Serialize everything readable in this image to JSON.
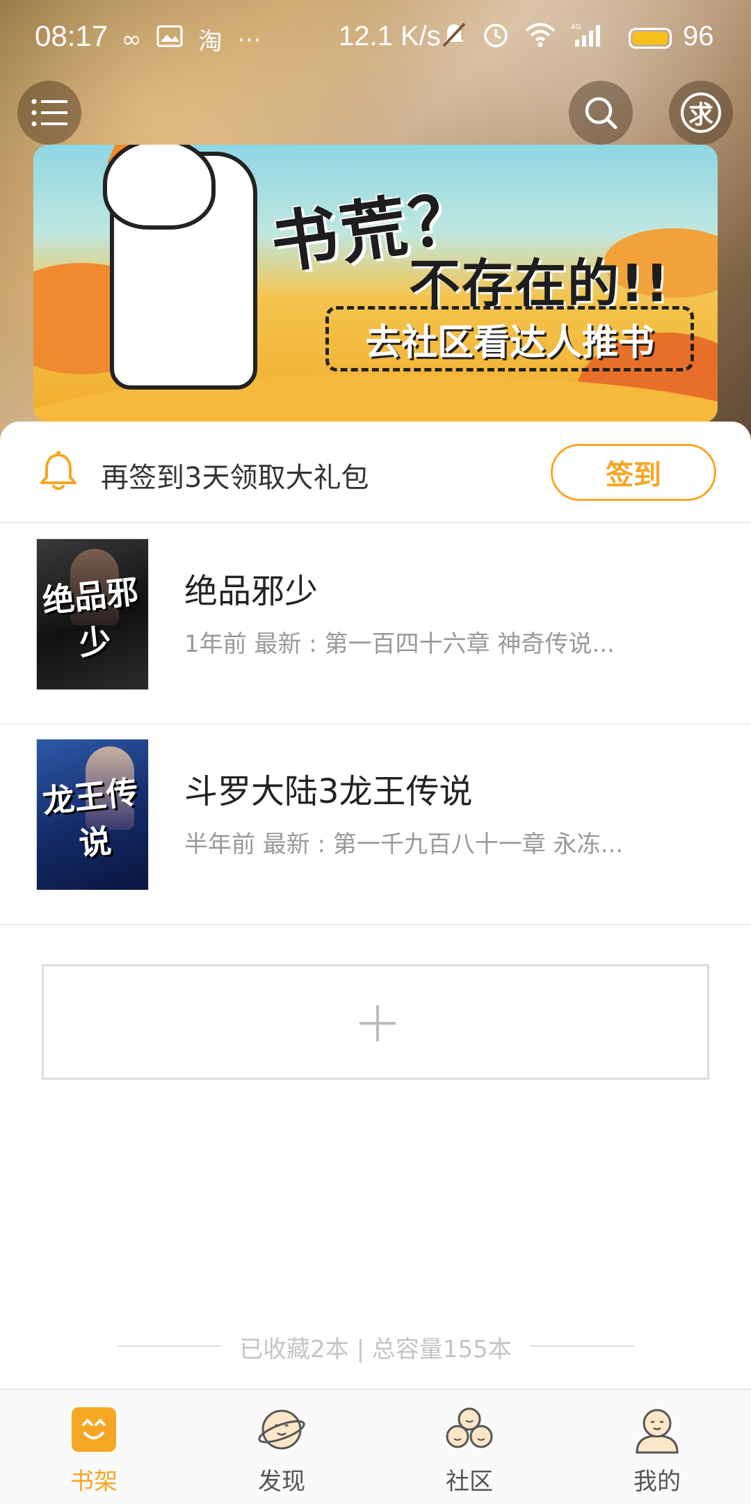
{
  "status_bar": {
    "time": "08:17",
    "net_speed": "12.1 K/s",
    "battery": "96",
    "left_icons": [
      "infinity-icon",
      "image-icon",
      "taobao-icon",
      "more-icon"
    ],
    "right_icons": [
      "mute-icon",
      "alarm-icon",
      "wifi-icon",
      "signal-4g-icon",
      "battery-icon"
    ]
  },
  "header": {
    "menu_icon": "menu-icon",
    "search_icon": "search-icon",
    "request_icon_text": "求"
  },
  "banner": {
    "headline": "书荒？",
    "subline": "不存在的!!",
    "cta": "去社区看达人推书"
  },
  "signin": {
    "text": "再签到3天领取大礼包",
    "button": "签到"
  },
  "books": [
    {
      "title": "绝品邪少",
      "subtitle": "1年前 最新 : 第一百四十六章 神奇传说...",
      "cover_title": "绝品邪少"
    },
    {
      "title": "斗罗大陆3龙王传说",
      "subtitle": "半年前 最新 : 第一千九百八十一章 永冻...",
      "cover_title": "龙王传说"
    }
  ],
  "footer": {
    "summary": "已收藏2本 | 总容量155本"
  },
  "tabs": [
    {
      "label": "书架",
      "icon": "bookshelf-icon",
      "active": true
    },
    {
      "label": "发现",
      "icon": "planet-face-icon",
      "active": false
    },
    {
      "label": "社区",
      "icon": "community-faces-icon",
      "active": false
    },
    {
      "label": "我的",
      "icon": "profile-face-icon",
      "active": false
    }
  ],
  "colors": {
    "accent": "#f5a623",
    "text_primary": "#222222",
    "text_secondary": "#999999"
  }
}
